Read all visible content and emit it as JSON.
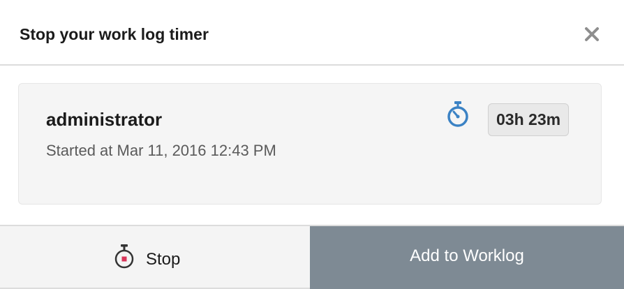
{
  "dialog": {
    "title": "Stop your work log timer",
    "close_icon": "close-icon"
  },
  "timer": {
    "user": "administrator",
    "started": "Started at Mar 11, 2016 12:43 PM",
    "duration": "03h 23m",
    "icon": "stopwatch-icon",
    "icon_color": "#3b82c4"
  },
  "actions": {
    "stop_label": "Stop",
    "stop_icon": "stopwatch-stop-icon",
    "stop_icon_color": "#d9365a",
    "add_label": "Add to Worklog",
    "add_bg": "#7e8a94"
  }
}
